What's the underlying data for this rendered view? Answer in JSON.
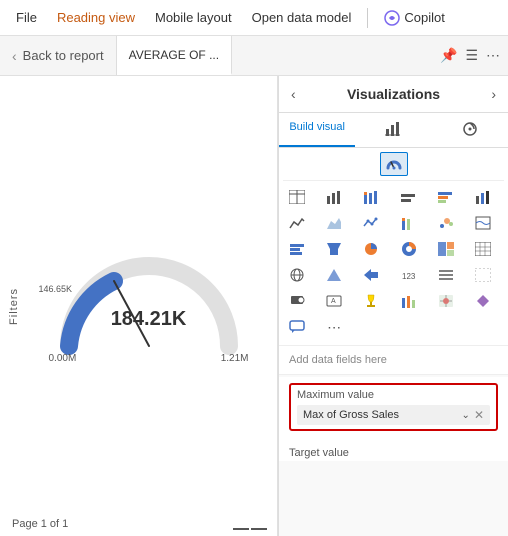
{
  "menubar": {
    "file_label": "File",
    "reading_view_label": "Reading view",
    "mobile_layout_label": "Mobile layout",
    "open_data_model_label": "Open data model",
    "copilot_label": "Copilot"
  },
  "tabbar": {
    "back_label": "Back to report",
    "active_tab_label": "AVERAGE OF ...",
    "icons": [
      "pin",
      "filter",
      "more"
    ]
  },
  "left_panel": {
    "filters_label": "Filters",
    "gauge": {
      "value": "184.21K",
      "min": "0.00M",
      "max": "1.21M",
      "side_label": "146.65K"
    },
    "page_indicator": "Page 1 of 1"
  },
  "right_panel": {
    "title": "Visualizations",
    "nav": [
      "‹",
      "›"
    ],
    "tabs": [
      {
        "label": "Build visual",
        "active": true
      },
      {
        "label": "",
        "active": false
      }
    ],
    "add_data_fields": "Add data fields here",
    "maximum_value_label": "Maximum value",
    "field_tag_label": "Max of Gross Sales",
    "target_value_label": "Target value"
  }
}
